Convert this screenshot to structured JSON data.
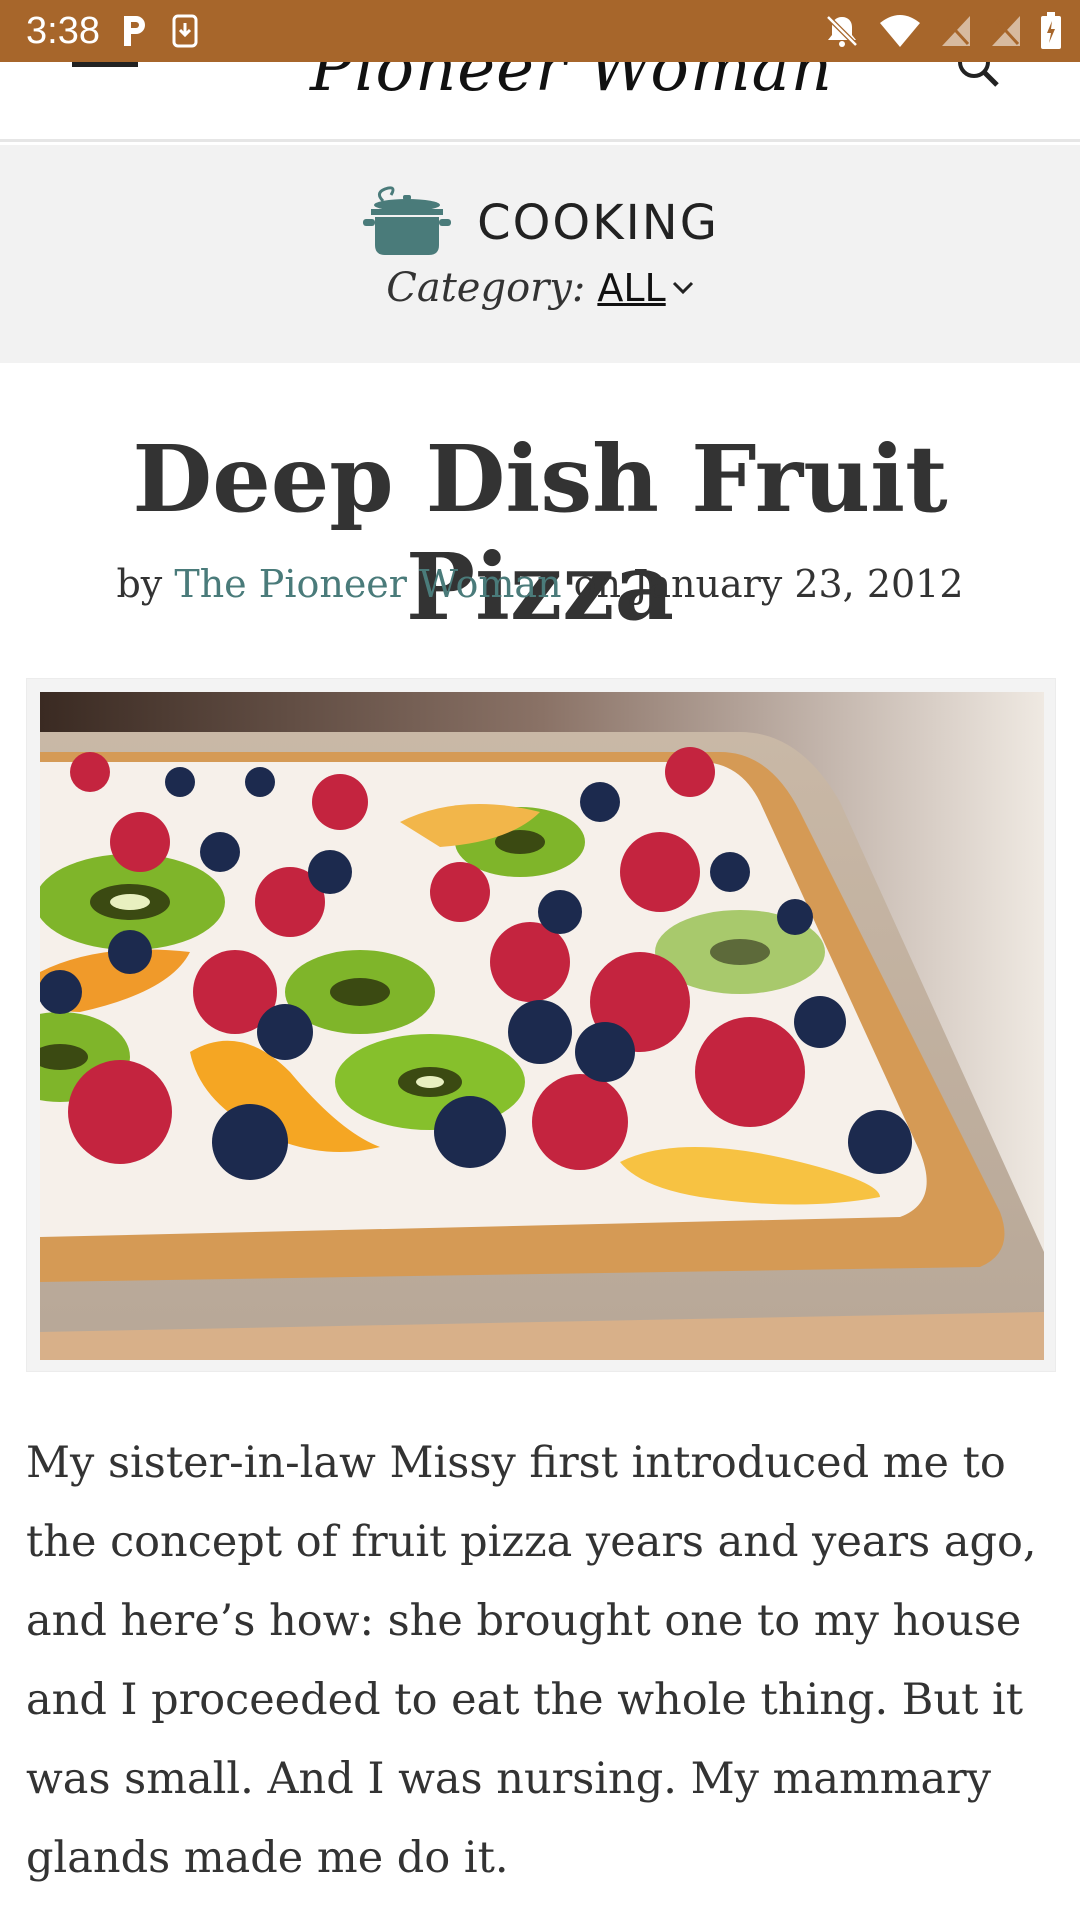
{
  "status_bar": {
    "time": "3:38"
  },
  "header": {
    "logo_text": "Pioneer Woman"
  },
  "category_banner": {
    "section_label": "COOKING",
    "category_label": "Category:",
    "category_value": "ALL"
  },
  "post": {
    "title": "Deep Dish Fruit Pizza",
    "by": "by",
    "author": "The Pioneer Woman",
    "on": "on",
    "date": "January 23, 2012",
    "body": "My sister-in-law Missy first introduced me to the concept of fruit pizza years and years ago, and here’s how: she brought one to my house and I proceeded to eat the whole thing. But it was small. And I was nursing. My mammary glands made me do it."
  },
  "colors": {
    "status_bar": "#a7662b",
    "accent_teal": "#4a7b7a",
    "banner_bg": "#f2f2f2",
    "text": "#333333"
  },
  "icons": {
    "status_left": [
      "parking-icon",
      "sim-download-icon"
    ],
    "status_right": [
      "notifications-off-icon",
      "wifi-icon",
      "signal-icon",
      "signal-icon",
      "battery-icon"
    ],
    "header": [
      "menu-icon",
      "search-icon"
    ],
    "banner": "cooking-pot-icon"
  }
}
